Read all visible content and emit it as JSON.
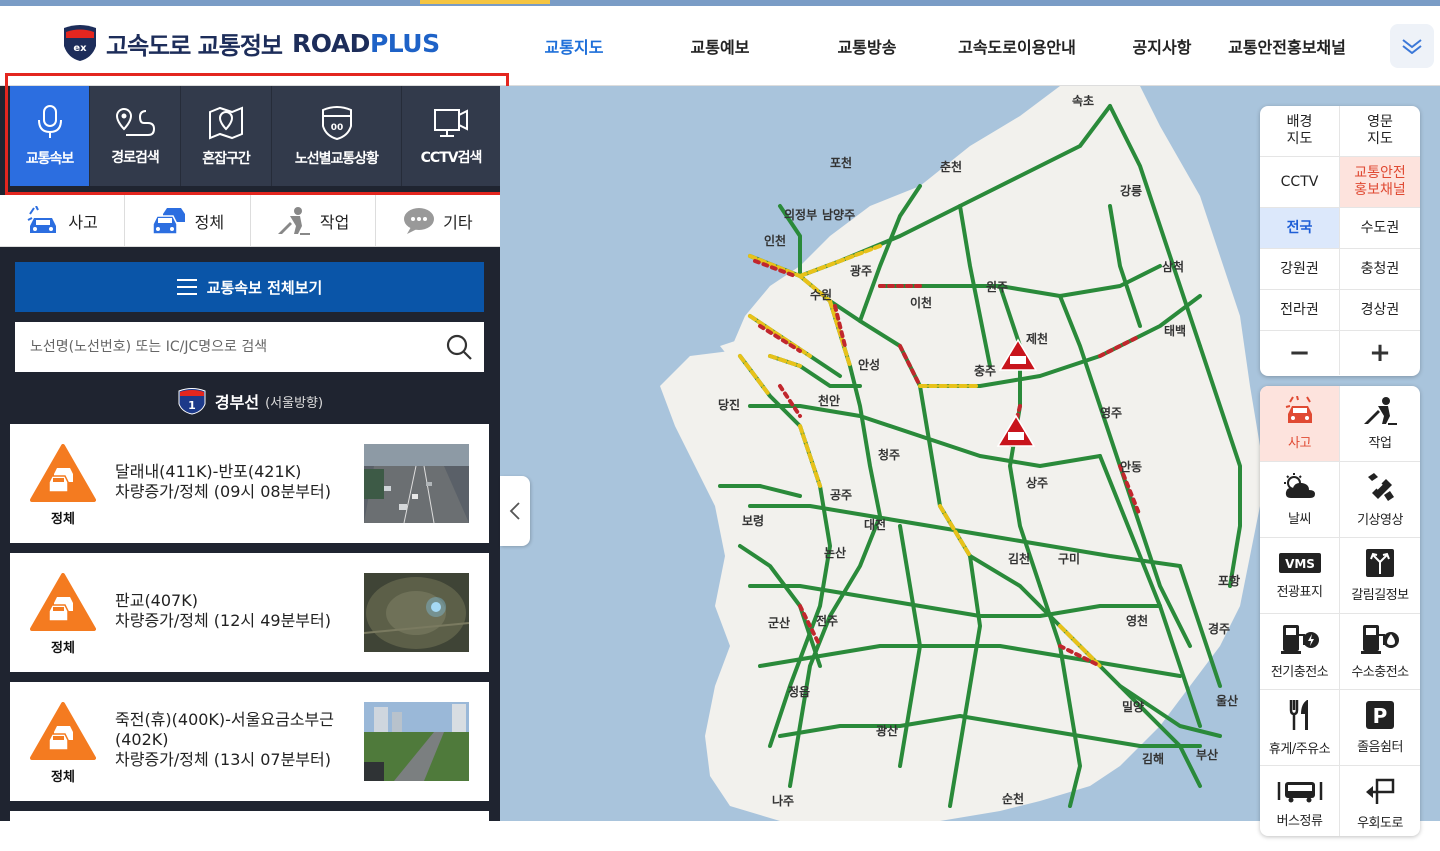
{
  "header": {
    "logo_badge": "ex",
    "title": "고속도로 교통정보",
    "brand_road": "ROAD",
    "brand_plus": "PLUS",
    "nav": [
      "교통지도",
      "교통예보",
      "교통방송",
      "고속도로이용안내",
      "공지사항",
      "교통안전홍보채널"
    ],
    "active_nav": "교통지도"
  },
  "sidebar": {
    "tabs": [
      {
        "label": "교통속보",
        "icon": "microphone-icon",
        "active": true
      },
      {
        "label": "경로검색",
        "icon": "route-icon"
      },
      {
        "label": "혼잡구간",
        "icon": "map-pin-icon"
      },
      {
        "label": "노선별교통상황",
        "icon": "highway-shield-icon"
      },
      {
        "label": "CCTV검색",
        "icon": "cctv-icon"
      }
    ],
    "filters": [
      {
        "label": "사고",
        "icon": "accident-car-icon"
      },
      {
        "label": "정체",
        "icon": "congestion-cars-icon"
      },
      {
        "label": "작업",
        "icon": "construction-worker-icon"
      },
      {
        "label": "기타",
        "icon": "speech-bubble-icon"
      }
    ],
    "full_view_label": "교통속보 전체보기",
    "search_placeholder": "노선명(노선번호) 또는 IC/JC명으로 검색",
    "route": {
      "number": "1",
      "name": "경부선",
      "direction": "(서울방향)"
    },
    "cards": [
      {
        "badge": "정체",
        "line1": "달래내(411K)-반포(421K)",
        "line2": "차량증가/정체 (09시 08분부터)"
      },
      {
        "badge": "정체",
        "line1": "판교(407K)",
        "line2": "차량증가/정체 (12시 49분부터)"
      },
      {
        "badge": "정체",
        "line1": "죽전(휴)(400K)-서울요금소부근(402K)",
        "line2": "차량증가/정체 (13시 07분부터)"
      }
    ]
  },
  "map": {
    "cities": [
      "속초",
      "포천",
      "춘천",
      "강릉",
      "의정부",
      "남양주",
      "인천",
      "광주",
      "삼척",
      "수원",
      "원주",
      "이천",
      "태백",
      "제천",
      "안성",
      "충주",
      "당진",
      "천안",
      "영주",
      "청주",
      "안동",
      "상주",
      "보령",
      "공주",
      "대전",
      "논산",
      "김천",
      "구미",
      "포항",
      "군산",
      "전주",
      "경주",
      "정읍",
      "영천",
      "밀양",
      "울산",
      "광산",
      "김해",
      "부산",
      "나주",
      "순천"
    ],
    "colors": {
      "free": "#2a8a3a",
      "slow": "#e8c21a",
      "jam": "#c1272d",
      "water": "#a9c4dc",
      "land": "#f2f1ed"
    }
  },
  "right_panel": {
    "layers": [
      "배경\n지도",
      "영문\n지도",
      "CCTV",
      "교통안전\n홍보채널"
    ],
    "regions": [
      "전국",
      "수도권",
      "강원권",
      "충청권",
      "전라권",
      "경상권"
    ],
    "selected_region": "전국",
    "zoom_out": "−",
    "zoom_in": "+",
    "tools": [
      {
        "label": "사고",
        "icon": "accident-icon",
        "active": true
      },
      {
        "label": "작업",
        "icon": "construction-icon"
      },
      {
        "label": "날씨",
        "icon": "weather-icon"
      },
      {
        "label": "기상영상",
        "icon": "satellite-icon"
      },
      {
        "label": "전광표지",
        "icon": "vms-sign-icon",
        "badge": "VMS"
      },
      {
        "label": "갈림길정보",
        "icon": "junction-icon"
      },
      {
        "label": "전기충전소",
        "icon": "ev-charger-icon"
      },
      {
        "label": "수소충전소",
        "icon": "hydrogen-station-icon"
      },
      {
        "label": "휴게/주유소",
        "icon": "rest-area-icon"
      },
      {
        "label": "졸음쉼터",
        "icon": "parking-icon",
        "badge": "P"
      },
      {
        "label": "버스정류",
        "icon": "bus-icon"
      },
      {
        "label": "우회도로",
        "icon": "detour-icon"
      }
    ]
  }
}
